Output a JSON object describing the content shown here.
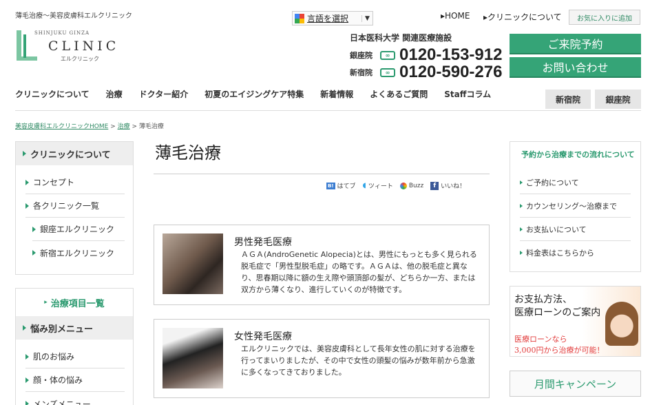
{
  "header": {
    "tagline": "薄毛治療～美容皮膚科エルクリニック",
    "logo": {
      "top": "SHINJUKU GINZA",
      "main": "CLINIC",
      "sub": "エルクリニック"
    },
    "translate_label": "言語を選択",
    "top_links": [
      "HOME",
      "クリニックについて"
    ],
    "favorite_label": "お気に入りに追加",
    "affiliation": "日本医科大学 関連医療施設",
    "phones": [
      {
        "branch": "銀座院",
        "number": "0120-153-912"
      },
      {
        "branch": "新宿院",
        "number": "0120-590-276"
      }
    ],
    "cta_visit": "ご来院予約",
    "cta_inquiry": "お問い合わせ"
  },
  "nav": {
    "items": [
      "クリニックについて",
      "治療",
      "ドクター紹介",
      "初夏のエイジングケア特集",
      "新着情報",
      "よくあるご質問",
      "Staffコラム"
    ],
    "branches": [
      "新宿院",
      "銀座院"
    ]
  },
  "breadcrumb": {
    "home": "美容皮膚科エルクリニックHOME",
    "sep": ">",
    "mid": "治療",
    "current": "薄毛治療"
  },
  "left": {
    "about_title": "クリニックについて",
    "about_items": [
      "コンセプト",
      "各クリニック一覧"
    ],
    "about_sub": [
      "銀座エルクリニック",
      "新宿エルクリニック"
    ],
    "treat_title": "治療項目一覧",
    "worry_title": "悩み別メニュー",
    "worry_items": [
      "肌のお悩み",
      "顔・体の悩み",
      "メンズメニュー"
    ]
  },
  "main": {
    "title": "薄毛治療",
    "social": [
      "はてブ",
      "ツィート",
      "Buzz",
      "いいね！"
    ],
    "cards": [
      {
        "title": "男性発毛医療",
        "text": "ＡＧＡ(AndroGenetic Alopecia)とは、男性にもっとも多く見られる脱毛症で「男性型脱毛症」の略です。ＡＧＡは、他の脱毛症と異なり、思春期以降に額の生え際や頭頂部の髪が、どちらか一方、または双方から薄くなり、進行していくのが特徴です。"
      },
      {
        "title": "女性発毛医療",
        "text": "エルクリニックでは、美容皮膚科として長年女性の肌に対する治療を行ってまいりましたが、その中で女性の頭髪の悩みが数年前から急激に多くなってきておりました。"
      }
    ]
  },
  "right": {
    "flow_title": "予約から治療までの流れについて",
    "flow_items": [
      "ご予約について",
      "カウンセリング～治療まで",
      "お支払いについて",
      "料金表はこちらから"
    ],
    "loan": {
      "line1": "お支払方法、",
      "line2": "医療ローンのご案内",
      "line3": "医療ローンなら",
      "line4": "3,000円から治療が可能！"
    },
    "campaign": "月間キャンペーン"
  },
  "colors": {
    "accent": "#35a477",
    "link": "#2f8a64"
  }
}
